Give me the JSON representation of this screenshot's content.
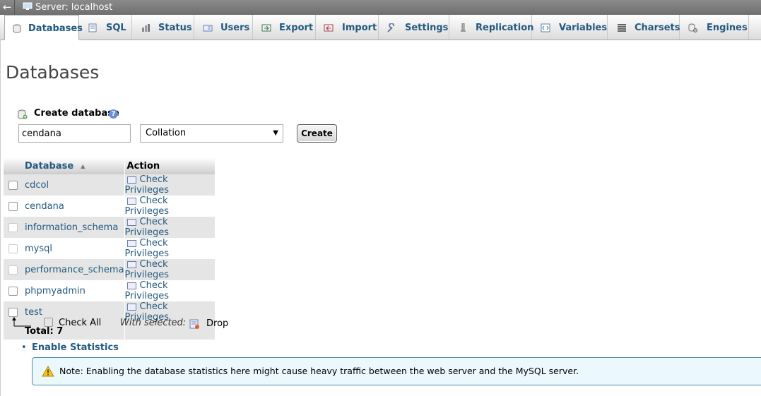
{
  "window": {
    "back_glyph": "←",
    "server_title": "Server: localhost",
    "server_icon": "server-icon"
  },
  "tabs": [
    {
      "label": "Databases",
      "icon": "database-icon",
      "active": true
    },
    {
      "label": "SQL",
      "icon": "sql-icon"
    },
    {
      "label": "Status",
      "icon": "status-icon"
    },
    {
      "label": "Users",
      "icon": "users-icon"
    },
    {
      "label": "Export",
      "icon": "export-icon"
    },
    {
      "label": "Import",
      "icon": "import-icon"
    },
    {
      "label": "Settings",
      "icon": "wrench-icon"
    },
    {
      "label": "Replication",
      "icon": "replication-icon"
    },
    {
      "label": "Variables",
      "icon": "variables-icon"
    },
    {
      "label": "Charsets",
      "icon": "charsets-icon"
    },
    {
      "label": "Engines",
      "icon": "engines-icon"
    }
  ],
  "page_title": "Databases",
  "create": {
    "label": "Create database",
    "help_glyph": "?",
    "db_name_value": "cendana",
    "collation_value": "Collation",
    "collation_arrow": "▼",
    "button_label": "Create"
  },
  "table": {
    "header_database": "Database",
    "header_action": "Action",
    "sort_glyph": "▲",
    "rows": [
      {
        "name": "cdcol",
        "action": "Check Privileges"
      },
      {
        "name": "cendana",
        "action": "Check Privileges"
      },
      {
        "name": "information_schema",
        "action": "Check Privileges"
      },
      {
        "name": "mysql",
        "action": "Check Privileges"
      },
      {
        "name": "performance_schema",
        "action": "Check Privileges"
      },
      {
        "name": "phpmyadmin",
        "action": "Check Privileges"
      },
      {
        "name": "test",
        "action": "Check Privileges"
      }
    ],
    "total_label": "Total: 7"
  },
  "bulk": {
    "check_all_label": "Check All",
    "with_selected_label": "With selected:",
    "drop_label": "Drop"
  },
  "stats": {
    "bullet": "•",
    "enable_label": "Enable Statistics",
    "note": "Note: Enabling the database statistics here might cause heavy traffic between the web server and the MySQL server."
  },
  "colors": {
    "link": "#235a81",
    "topbar": "#7a7a7a",
    "notice_bg": "#ebf8fd",
    "notice_border": "#4f8ea7"
  }
}
